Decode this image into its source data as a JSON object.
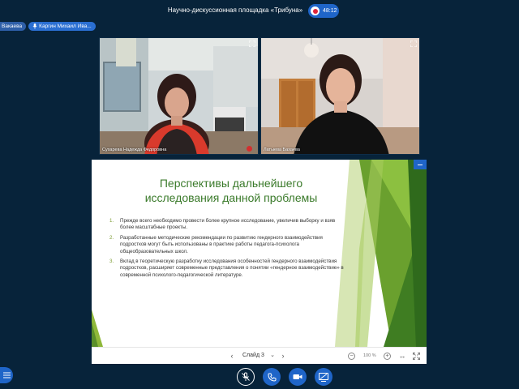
{
  "header": {
    "meeting_title": "Научно-дискуссионная площадка «Трибуна»",
    "recording_time": "48:12"
  },
  "talkers": [
    {
      "name": "Вакаева"
    },
    {
      "name": "Каргин Михаил Ива..."
    }
  ],
  "videos": [
    {
      "name": "Сухарева Надежда Федоровна"
    },
    {
      "name": "Латыева Бахаева"
    }
  ],
  "slide": {
    "title": "Перспективы дальнейшего исследования данной проблемы",
    "items": [
      {
        "num": "1.",
        "text": "Прежде всего необходимо провести более крупное исследование, увеличив выборку и взяв более масштабные проекты."
      },
      {
        "num": "2.",
        "text": "Разработанные методические рекомендации по развитию гендерного взаимодействия подростков могут быть использованы в практике работы педагога-психолога общеобразовательных школ."
      },
      {
        "num": "3.",
        "text": "Вклад в теоретическую разработку исследования особенностей гендерного взаимодействия подростков, расширяет современные представления о понятии «гендерное взаимодействие» в современной психолого-педагогической литературе."
      }
    ]
  },
  "presentation_toolbar": {
    "slide_label": "Слайд 3",
    "zoom": "100 %"
  },
  "colors": {
    "background": "#07233a",
    "accent": "#1f65c8",
    "slide_green": "#3a7a2a"
  }
}
